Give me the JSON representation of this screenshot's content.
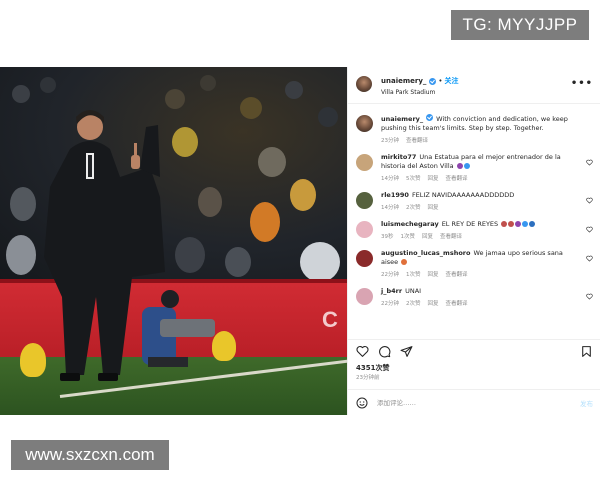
{
  "watermarks": {
    "top": "TG: MYYJJPP",
    "bottom": "www.sxzcxn.com"
  },
  "photo": {
    "board_text": "C"
  },
  "header": {
    "username": "unaiemery_",
    "separator": "•",
    "follow_label": "关注",
    "location": "Villa Park Stadium",
    "more_label": "•••"
  },
  "caption": {
    "username": "unaiemery_",
    "text": "With conviction and dedication, we keep pushing this team's limits. Step by step. Together.",
    "time": "23分钟",
    "see_translation": "查看翻译"
  },
  "comments": [
    {
      "username": "mirkito77",
      "text": "Una Estatua para el mejor entrenador de la historia del Aston Villa",
      "emoji": [
        "#8e44ad",
        "#3897f0"
      ],
      "time": "14分钟",
      "likes": "5次赞",
      "reply": "回复",
      "translate": "查看翻译",
      "avatar_color": "#c7a47a"
    },
    {
      "username": "rle1990",
      "text": "FELIZ NAVIDAAAAAAADDDDDD",
      "emoji": [],
      "time": "14分钟",
      "likes": "2次赞",
      "reply": "回复",
      "translate": "",
      "avatar_color": "#56613e"
    },
    {
      "username": "luismechegaray",
      "text": "EL REY DE REYES",
      "emoji": [
        "#c0504d",
        "#c0504d",
        "#8e44ad",
        "#3897f0",
        "#2c6fbf"
      ],
      "time": "39秒",
      "likes": "1次赞",
      "reply": "回复",
      "translate": "查看翻译",
      "avatar_color": "#e8b4c0"
    },
    {
      "username": "augustino_lucas_mshoro",
      "text": "We jamaa upo serious sana aisee",
      "emoji": [
        "#e0703a"
      ],
      "time": "22分钟",
      "likes": "1次赞",
      "reply": "回复",
      "translate": "查看翻译",
      "avatar_color": "#8a2a2a"
    },
    {
      "username": "j_b4rr",
      "text": "UNAI",
      "emoji": [],
      "time": "22分钟",
      "likes": "2次赞",
      "reply": "回复",
      "translate": "查看翻译",
      "avatar_color": "#d9a4b2"
    }
  ],
  "footer": {
    "likes": "4351次赞",
    "time": "23分钟前",
    "comment_placeholder": "添加评论……",
    "post_label": "发布"
  },
  "colors": {
    "accent": "#0095f6",
    "text": "#262626",
    "muted": "#8e8e8e",
    "board_red": "#c62830"
  },
  "icons": [
    "heart-icon",
    "comment-icon",
    "share-icon",
    "bookmark-icon",
    "smile-icon",
    "verified-icon"
  ]
}
